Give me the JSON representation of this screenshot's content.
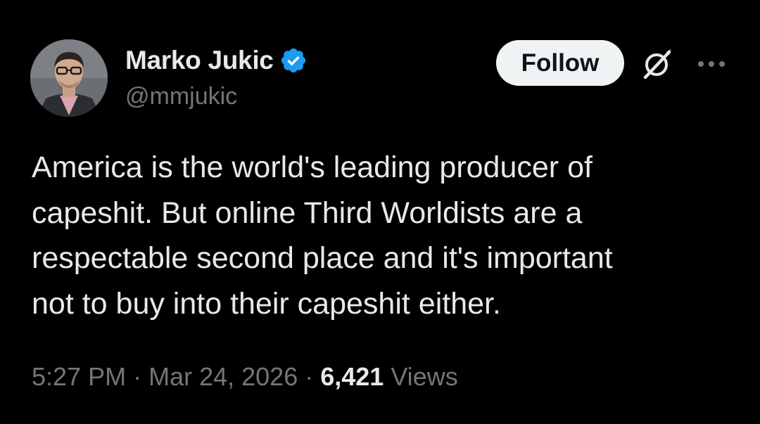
{
  "author": {
    "display_name": "Marko Jukic",
    "handle": "@mmjukic",
    "verified": true,
    "verified_color": "#1d9bf0",
    "avatar_icon": "profile-photo"
  },
  "actions": {
    "follow_label": "Follow",
    "grok_icon": "grok-icon",
    "more_icon": "more-horizontal-icon"
  },
  "tweet": {
    "text": "America is the world's leading producer of\ncapeshit. But online Third Worldists are a\nrespectable second place and it's important\nnot to buy into their capeshit either."
  },
  "meta": {
    "time": "5:27 PM",
    "separator": "·",
    "date": "Mar 24, 2026",
    "views_count": "6,421",
    "views_label": "Views"
  },
  "colors": {
    "background": "#000000",
    "primary_text": "#e7e9ea",
    "secondary_text": "#71767b",
    "follow_bg": "#eff3f4",
    "follow_text": "#0f1419"
  }
}
